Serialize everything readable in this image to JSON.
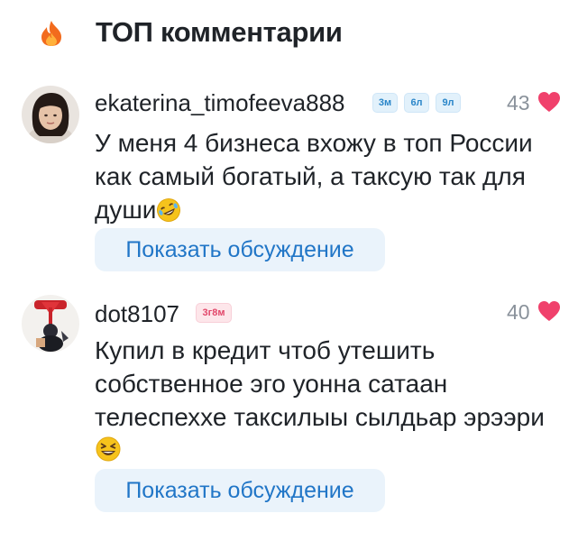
{
  "header": {
    "title": "ТОП комментарии",
    "icon": "fire-icon"
  },
  "comments": [
    {
      "username": "ekaterina_timofeeva888",
      "badges": [
        "3м",
        "6л",
        "9л"
      ],
      "likes": "43",
      "text_lines": [
        "У меня 4 бизнеса вхожу в топ России",
        "как самый богатый, а таксую так для",
        "души"
      ],
      "emoji": "rolling-on-floor-laughing",
      "button": "Показать обсуждение"
    },
    {
      "username": "dot8107",
      "badges": [
        "3г8м"
      ],
      "likes": "40",
      "text_lines": [
        "Купил в кредит чтоб утешить",
        "собственное эго уонна сатаан",
        "телеспеххе таксилыы сылдьар эрээри"
      ],
      "emoji": "grinning-squinting-face",
      "button": "Показать обсуждение"
    }
  ],
  "colors": {
    "like_heart": "#f0416c",
    "accent_blue": "#2176c7",
    "button_bg": "#eaf3fb",
    "fire": "#f26b1d"
  }
}
